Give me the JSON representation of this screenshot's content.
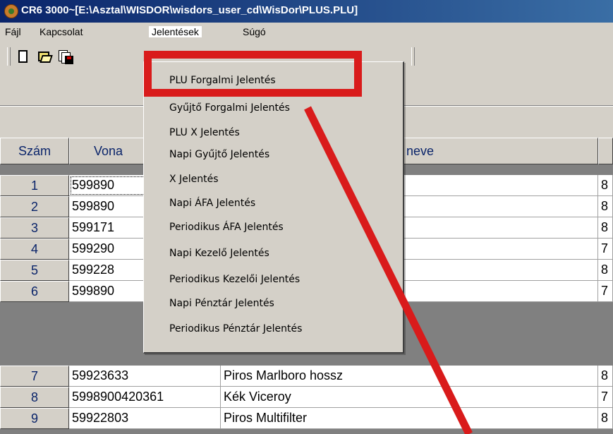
{
  "window": {
    "title": "CR6 3000~[E:\\Asztal\\WISDOR\\wisdors_user_cd\\WisDor\\PLUS.PLU]",
    "app_icon": "cash-register-icon"
  },
  "menubar": {
    "items": [
      {
        "label": "Fájl"
      },
      {
        "label": "Kapcsolat"
      },
      {
        "label": "Jelentések"
      },
      {
        "label": "Súgó"
      }
    ]
  },
  "toolbar": {
    "buttons": [
      {
        "icon": "new-file-icon"
      },
      {
        "icon": "open-folder-icon"
      },
      {
        "icon": "save-icon"
      }
    ]
  },
  "grid": {
    "columns": [
      "Szám",
      "Vona",
      "neve",
      ""
    ],
    "rows": [
      {
        "num": "1",
        "code": "599890",
        "name": "",
        "extra": "8"
      },
      {
        "num": "2",
        "code": "599890",
        "name": "",
        "extra": "8"
      },
      {
        "num": "3",
        "code": "599171",
        "name": "",
        "extra": "8"
      },
      {
        "num": "4",
        "code": "599290",
        "name": "",
        "extra": "7"
      },
      {
        "num": "5",
        "code": "599228",
        "name": "",
        "extra": "8"
      },
      {
        "num": "6",
        "code": "599890",
        "name": "",
        "extra": "7"
      },
      {
        "num": "7",
        "code": "59923633",
        "name": "Piros Marlboro hossz",
        "extra": "8"
      },
      {
        "num": "8",
        "code": "5998900420361",
        "name": "Kék Viceroy",
        "extra": "7"
      },
      {
        "num": "9",
        "code": "59922803",
        "name": "Piros Multifilter",
        "extra": "8"
      }
    ]
  },
  "dropdown": {
    "items": [
      {
        "label": "PLU Forgalmi Jelentés"
      },
      {
        "label": "Gyűjtő Forgalmi Jelentés"
      },
      {
        "label": "PLU X Jelentés"
      },
      {
        "label": "Napi Gyűjtő Jelentés"
      },
      {
        "label": "X Jelentés"
      },
      {
        "label": "Napi ÁFA Jelentés"
      },
      {
        "label": "Periodikus ÁFA Jelentés"
      },
      {
        "label": "Napi Kezelő Jelentés"
      },
      {
        "label": "Periodikus Kezelői Jelentés"
      },
      {
        "label": "Napi Pénztár Jelentés"
      },
      {
        "label": "Periodikus Pénztár Jelentés"
      }
    ]
  },
  "annotation": {
    "color": "#d91b1b"
  }
}
